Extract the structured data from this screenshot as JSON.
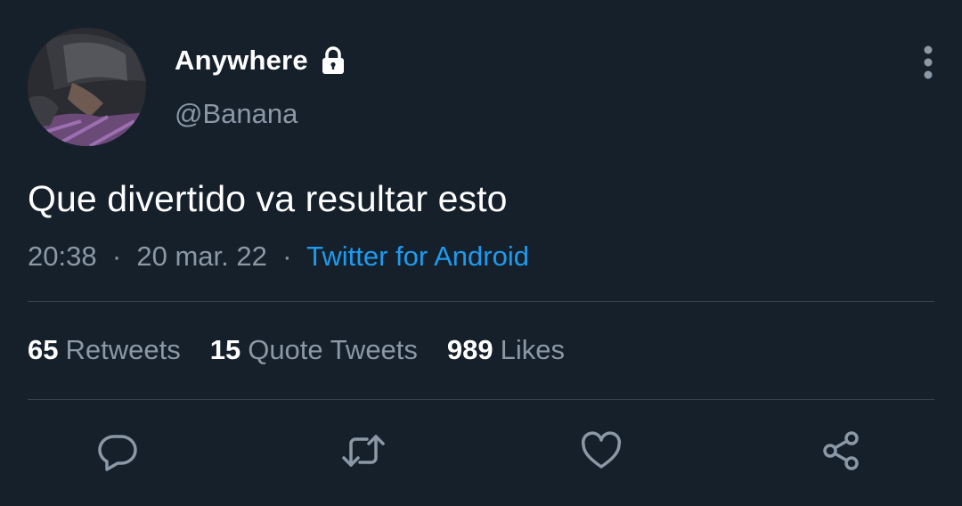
{
  "tweet": {
    "author": {
      "display_name": "Anywhere",
      "handle": "@Banana",
      "protected_icon": "lock-icon",
      "avatar": "profile-photo"
    },
    "more_icon": "more-vertical-icon",
    "text": "Que divertido va resultar esto",
    "time": "20:38",
    "date": "20 mar. 22",
    "separator": "·",
    "source": "Twitter for Android",
    "stats": [
      {
        "count": "65",
        "label": "Retweets"
      },
      {
        "count": "15",
        "label": "Quote Tweets"
      },
      {
        "count": "989",
        "label": "Likes"
      }
    ],
    "actions": [
      "reply-icon",
      "retweet-icon",
      "like-icon",
      "share-icon"
    ]
  },
  "colors": {
    "background": "#15202b",
    "text_primary": "#ffffff",
    "text_secondary": "#8b98a5",
    "link": "#1d9bf0",
    "divider": "#38444d"
  }
}
